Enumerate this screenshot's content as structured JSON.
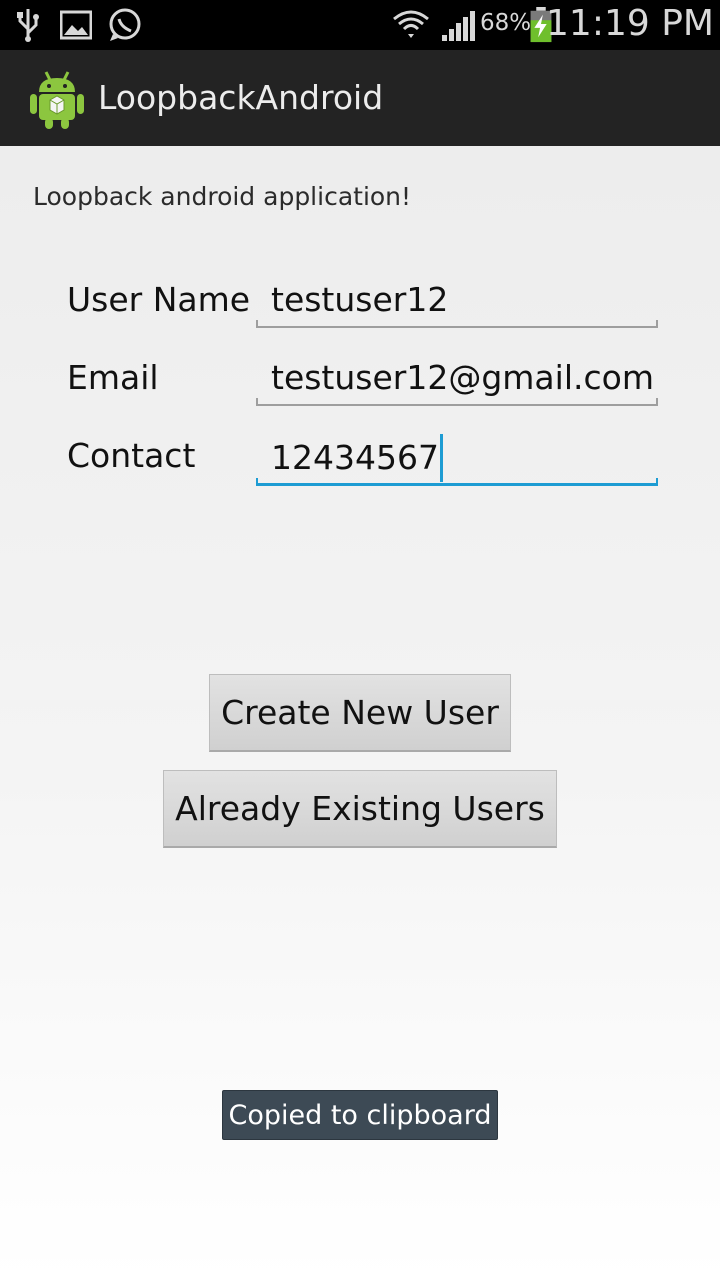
{
  "status_bar": {
    "icons_left": [
      "usb-icon",
      "image-icon",
      "whatsapp-icon"
    ],
    "icons_right": [
      "wifi-icon",
      "signal-icon",
      "battery-charging-icon"
    ],
    "battery": "68%",
    "time": "11:19 PM"
  },
  "action_bar": {
    "title": "LoopbackAndroid",
    "icon": "android-icon"
  },
  "main": {
    "intro": "Loopback android application!",
    "fields": [
      {
        "label": "User Name",
        "value": "testuser12"
      },
      {
        "label": "Email",
        "value": "testuser12@gmail.com"
      },
      {
        "label": "Contact",
        "value": "12434567"
      }
    ],
    "buttons": {
      "create": "Create New User",
      "existing": "Already Existing Users"
    }
  },
  "toast": "Copied to clipboard",
  "colors": {
    "accent": "#1e9cd3",
    "action_bar": "#232323",
    "toast_bg": "#3d4a55"
  }
}
